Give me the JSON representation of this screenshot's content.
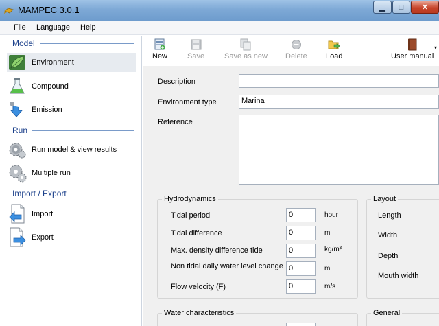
{
  "window": {
    "title": "MAMPEC 3.0.1",
    "min_glyph": "▁",
    "max_glyph": "□",
    "close_glyph": "✕"
  },
  "menu": {
    "file": "File",
    "language": "Language",
    "help": "Help"
  },
  "sidebar": {
    "model_header": "Model",
    "run_header": "Run",
    "io_header": "Import / Export",
    "items": {
      "environment": "Environment",
      "compound": "Compound",
      "emission": "Emission",
      "run_model": "Run model & view results",
      "multiple_run": "Multiple run",
      "import": "Import",
      "export": "Export"
    }
  },
  "toolbar": {
    "new": "New",
    "save": "Save",
    "save_as_new": "Save as new",
    "delete": "Delete",
    "load": "Load",
    "user_manual": "User manual",
    "dropdown_glyph": "▾"
  },
  "form": {
    "description_label": "Description",
    "description_value": "",
    "environment_type_label": "Environment type",
    "environment_type_value": "Marina",
    "reference_label": "Reference",
    "reference_value": ""
  },
  "hydrodynamics": {
    "title": "Hydrodynamics",
    "rows": [
      {
        "label": "Tidal period",
        "value": "0",
        "unit": "hour"
      },
      {
        "label": "Tidal difference",
        "value": "0",
        "unit": "m"
      },
      {
        "label": "Max. density difference tide",
        "value": "0",
        "unit": "kg/m³"
      },
      {
        "label": "Non tidal daily water level change",
        "value": "0",
        "unit": "m"
      },
      {
        "label": "Flow velocity (F)",
        "value": "0",
        "unit": "m/s"
      }
    ]
  },
  "layout": {
    "title": "Layout",
    "labels": [
      "Length",
      "Width",
      "Depth",
      "Mouth width"
    ]
  },
  "water_characteristics": {
    "title": "Water characteristics"
  },
  "general": {
    "title": "General"
  },
  "colors": {
    "accent": "#1a3f8a",
    "titlebar": "#7ea9d6",
    "close": "#c7442a",
    "form_bg": "#f0f0f0"
  }
}
